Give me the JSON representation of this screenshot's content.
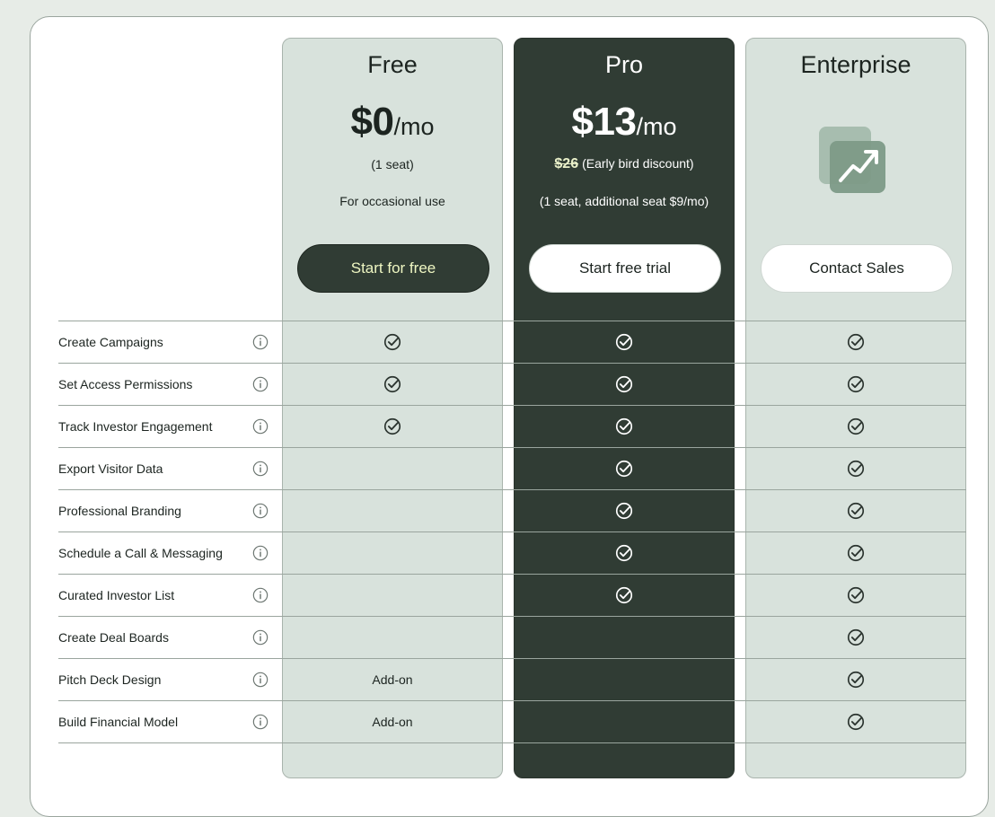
{
  "plans": [
    {
      "name": "Free",
      "price": "$0",
      "per": "/mo",
      "line1": "(1 seat)",
      "line2": "For occasional use",
      "cta": "Start for free"
    },
    {
      "name": "Pro",
      "price": "$13",
      "per": "/mo",
      "old_price": "$26",
      "line1": "(Early bird discount)",
      "line2": "(1 seat, additional seat $9/mo)",
      "cta": "Start free trial"
    },
    {
      "name": "Enterprise",
      "cta": "Contact Sales",
      "illustration": "trending-up-chart-icon"
    }
  ],
  "features": [
    {
      "label": "Create Campaigns",
      "free": "check",
      "pro": "check",
      "enterprise": "check"
    },
    {
      "label": "Set Access Permissions",
      "free": "check",
      "pro": "check",
      "enterprise": "check"
    },
    {
      "label": "Track Investor Engagement",
      "free": "check",
      "pro": "check",
      "enterprise": "check"
    },
    {
      "label": "Export Visitor Data",
      "free": "",
      "pro": "check",
      "enterprise": "check"
    },
    {
      "label": "Professional Branding",
      "free": "",
      "pro": "check",
      "enterprise": "check"
    },
    {
      "label": "Schedule a Call & Messaging",
      "free": "",
      "pro": "check",
      "enterprise": "check"
    },
    {
      "label": "Curated Investor List",
      "free": "",
      "pro": "check",
      "enterprise": "check"
    },
    {
      "label": "Create Deal Boards",
      "free": "",
      "pro": "",
      "enterprise": "check"
    },
    {
      "label": "Pitch Deck Design",
      "free": "Add-on",
      "pro": "",
      "enterprise": "check"
    },
    {
      "label": "Build Financial Model",
      "free": "Add-on",
      "pro": "",
      "enterprise": "check"
    }
  ],
  "colors": {
    "dark": "#303c34",
    "light": "#d8e2dc",
    "accent_text": "#eef6c2"
  }
}
